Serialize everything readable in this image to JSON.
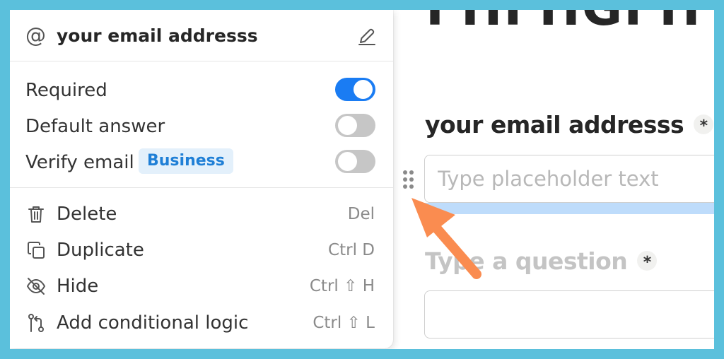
{
  "popup": {
    "field_name": "your email addresss",
    "at_symbol": "@",
    "options": [
      {
        "label": "Required",
        "enabled": true
      },
      {
        "label": "Default answer",
        "enabled": false
      },
      {
        "label": "Verify email",
        "badge": "Business",
        "enabled": false
      }
    ],
    "actions": [
      {
        "label": "Delete",
        "shortcut": "Del",
        "icon": "trash-icon"
      },
      {
        "label": "Duplicate",
        "shortcut": "Ctrl D",
        "icon": "duplicate-icon"
      },
      {
        "label": "Hide",
        "shortcut": "Ctrl ⇧ H",
        "icon": "eye-off-icon"
      },
      {
        "label": "Add conditional logic",
        "shortcut": "Ctrl ⇧ L",
        "icon": "branch-icon"
      }
    ]
  },
  "form": {
    "heading_partial": "FHFHGFH",
    "question1": {
      "title": "your email addresss",
      "required_mark": "*",
      "placeholder": "Type placeholder text"
    },
    "question2": {
      "title": "Type a question",
      "required_mark": "*"
    }
  },
  "colors": {
    "frame": "#5bc0dc",
    "toggle_on": "#1a7cf3",
    "toggle_off": "#c6c6c6",
    "business_badge_bg": "#e3f0fb",
    "business_badge_text": "#1f7fd6",
    "arrow": "#fa8c50",
    "input_focus_bar": "#bedcfb"
  }
}
